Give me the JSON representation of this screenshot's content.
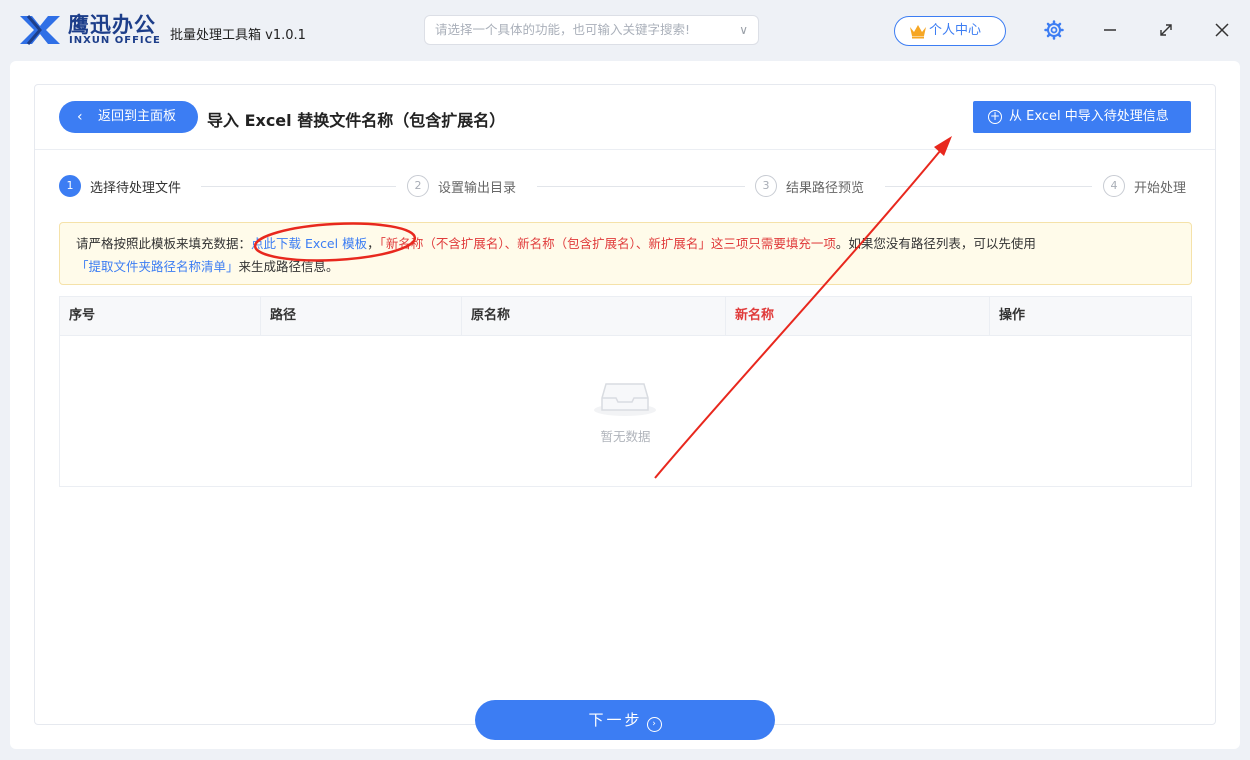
{
  "app": {
    "brand_cn": "鹰迅办公",
    "brand_en": "INXUN OFFICE",
    "title": "批量处理工具箱 v1.0.1"
  },
  "search": {
    "placeholder": "请选择一个具体的功能，也可输入关键字搜索!",
    "chevron": "∨"
  },
  "header": {
    "personal_center": "个人中心"
  },
  "page": {
    "back_label": "返回到主面板",
    "title": "导入 Excel 替换文件名称（包含扩展名）",
    "import_label": "从 Excel 中导入待处理信息"
  },
  "steps": [
    {
      "num": "1",
      "label": "选择待处理文件"
    },
    {
      "num": "2",
      "label": "设置输出目录"
    },
    {
      "num": "3",
      "label": "结果路径预览"
    },
    {
      "num": "4",
      "label": "开始处理"
    }
  ],
  "notice": {
    "prefix": "请严格按照此模板来填充数据：",
    "download_link": "点此下载 Excel 模板",
    "comma": "，",
    "red_text": "「新名称（不含扩展名）、新名称（包含扩展名）、新扩展名」这三项只需要填充一项",
    "middle": "。如果您没有路径列表，可以先使用",
    "extract_link": "「提取文件夹路径名称清单」",
    "suffix": "来生成路径信息。"
  },
  "table": {
    "columns": [
      "序号",
      "路径",
      "原名称",
      "新名称",
      "操作"
    ],
    "empty_text": "暂无数据"
  },
  "footer": {
    "next_label": "下一步"
  },
  "colors": {
    "accent": "#3c7df3",
    "warning_text": "#e03c3c",
    "notice_bg": "#fffbea",
    "annotation": "#e8281e"
  }
}
